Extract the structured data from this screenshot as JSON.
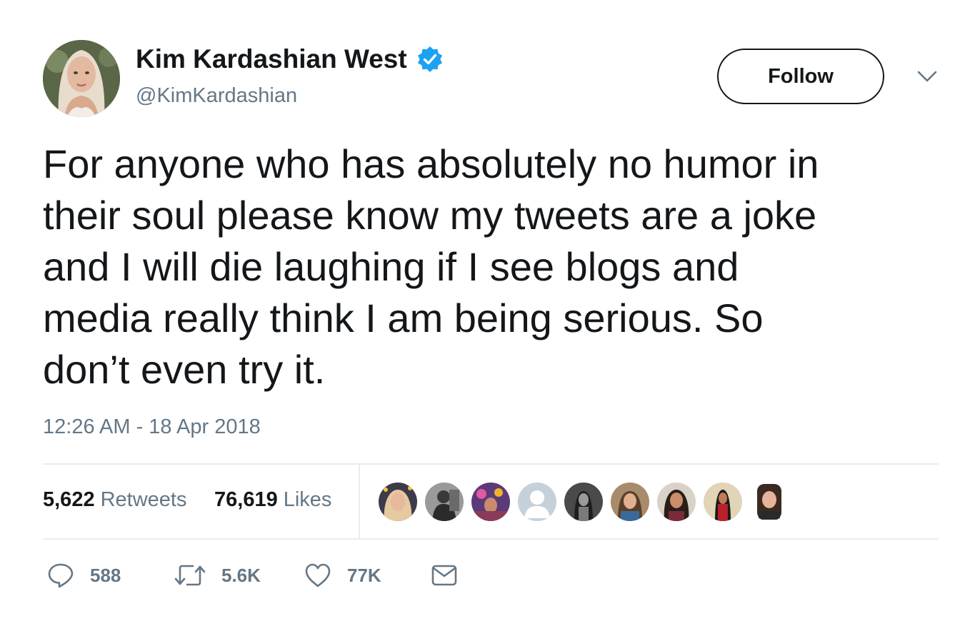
{
  "user": {
    "display_name": "Kim Kardashian West",
    "handle": "@KimKardashian",
    "verified": true,
    "follow_label": "Follow"
  },
  "tweet": {
    "text_lines": [
      "For anyone who has absolutely no humor in",
      "their soul please know my tweets are a joke",
      "and I will die laughing if I see blogs and",
      "media really think I am being serious. So",
      "don’t even try it."
    ],
    "timestamp": "12:26 AM - 18 Apr 2018"
  },
  "stats": {
    "retweets_count": "5,622",
    "retweets_label": "Retweets",
    "likes_count": "76,619",
    "likes_label": "Likes"
  },
  "actions": {
    "reply_count": "588",
    "retweet_count": "5.6K",
    "like_count": "77K"
  },
  "colors": {
    "text": "#14171a",
    "secondary": "#657786",
    "verified": "#1da1f2",
    "divider": "#e6ecf0"
  },
  "icons": [
    "verified-badge-icon",
    "chevron-down-icon",
    "reply-icon",
    "retweet-icon",
    "like-icon",
    "direct-message-icon"
  ]
}
